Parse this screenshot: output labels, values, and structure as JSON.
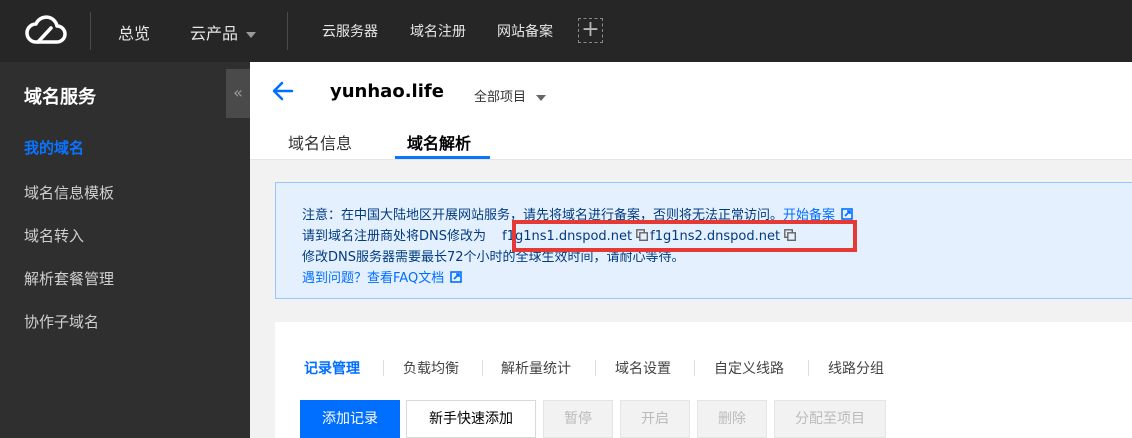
{
  "topbar": {
    "logo_icon": "cloud-logo-icon",
    "nav": {
      "overview": "总览",
      "products": "云产品"
    },
    "shortcuts": [
      "云服务器",
      "域名注册",
      "网站备案"
    ],
    "add_icon": "plus-icon"
  },
  "sidebar": {
    "title": "域名服务",
    "collapse_icon": "«",
    "items": [
      {
        "label": "我的域名",
        "active": true
      },
      {
        "label": "域名信息模板"
      },
      {
        "label": "域名转入"
      },
      {
        "label": "解析套餐管理"
      },
      {
        "label": "协作子域名"
      }
    ]
  },
  "header": {
    "domain": "yunhao.life",
    "project": "全部项目",
    "tabs": [
      {
        "label": "域名信息"
      },
      {
        "label": "域名解析",
        "active": true
      }
    ]
  },
  "notice": {
    "line1": "注意：在中国大陆地区开展网站服务，请先将域名进行备案，否则将无法正常访问。",
    "line1_link": "开始备案",
    "line2_prefix": "请到域名注册商处将DNS修改为",
    "ns1": "f1g1ns1.dnspod.net",
    "ns2": "f1g1ns2.dnspod.net",
    "line3": "修改DNS服务器需要最长72个小时的全球生效时间，请耐心等待。",
    "line4_prefix": "遇到问题？",
    "line4_link": "查看FAQ文档"
  },
  "records": {
    "subtabs": [
      "记录管理",
      "负载均衡",
      "解析量统计",
      "域名设置",
      "自定义线路",
      "线路分组"
    ],
    "buttons": {
      "add": "添加记录",
      "quick_add": "新手快速添加",
      "pause": "暂停",
      "enable": "开启",
      "delete": "删除",
      "assign": "分配至项目"
    }
  },
  "colors": {
    "accent": "#006eff",
    "highlight_box": "#e53935"
  }
}
